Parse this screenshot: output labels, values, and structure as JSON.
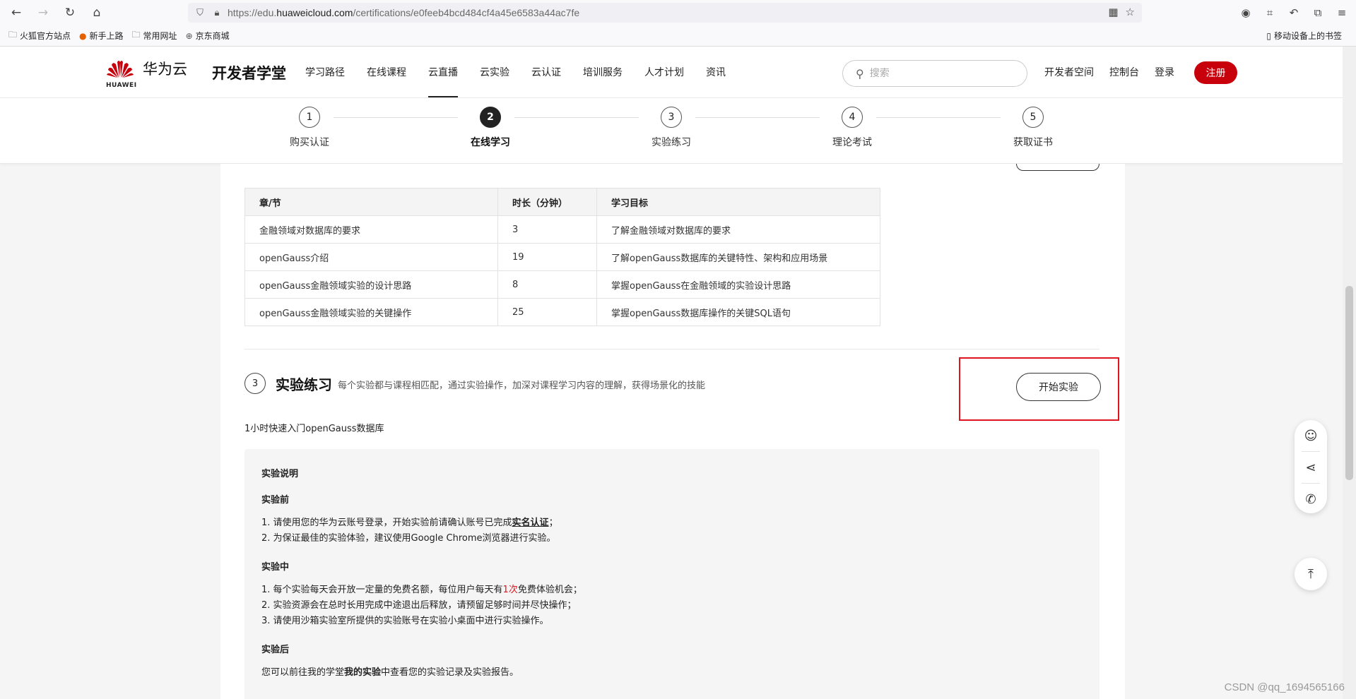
{
  "browser": {
    "url_prefix": "https://edu.",
    "url_domain": "huaweicloud.com",
    "url_path": "/certifications/e0feeb4bcd484cf4a45e6583a44ac7fe"
  },
  "bookmarks": {
    "items": [
      "火狐官方站点",
      "新手上路",
      "常用网址",
      "京东商城"
    ],
    "mobile": "移动设备上的书签"
  },
  "header": {
    "logo_caption": "HUAWEI",
    "logo_name": "华为云",
    "site_title": "开发者学堂",
    "nav": [
      "学习路径",
      "在线课程",
      "云直播",
      "云实验",
      "云认证",
      "培训服务",
      "人才计划",
      "资讯"
    ],
    "active_nav": 2,
    "search_placeholder": "搜索",
    "links": [
      "开发者空间",
      "控制台",
      "登录"
    ],
    "register": "注册"
  },
  "steps": [
    {
      "num": "1",
      "label": "购买认证"
    },
    {
      "num": "2",
      "label": "在线学习"
    },
    {
      "num": "3",
      "label": "实验练习"
    },
    {
      "num": "4",
      "label": "理论考试"
    },
    {
      "num": "5",
      "label": "获取证书"
    }
  ],
  "table": {
    "headers": [
      "章/节",
      "时长（分钟）",
      "学习目标"
    ],
    "rows": [
      [
        "金融领域对数据库的要求",
        "3",
        "了解金融领域对数据库的要求"
      ],
      [
        "openGauss介绍",
        "19",
        "了解openGauss数据库的关键特性、架构和应用场景"
      ],
      [
        "openGauss金融领域实验的设计思路",
        "8",
        "掌握openGauss在金融领域的实验设计思路"
      ],
      [
        "openGauss金融领域实验的关键操作",
        "25",
        "掌握openGauss数据库操作的关键SQL语句"
      ]
    ]
  },
  "section": {
    "num": "3",
    "title": "实验练习",
    "desc": "每个实验都与课程相匹配，通过实验操作，加深对课程学习内容的理解，获得场景化的技能",
    "start_button": "开始实验",
    "lab_name": "1小时快速入门openGauss数据库"
  },
  "lab": {
    "title": "实验说明",
    "before_title": "实验前",
    "before_1a": "1. 请使用您的华为云账号登录，开始实验前请确认账号已完成",
    "before_1b": "实名认证",
    "before_1c": "；",
    "before_2": "2. 为保证最佳的实验体验，建议使用Google Chrome浏览器进行实验。",
    "during_title": "实验中",
    "during_1a": "1. 每个实验每天会开放一定量的免费名额，每位用户每天有",
    "during_1b": "1次",
    "during_1c": "免费体验机会；",
    "during_2": "2. 实验资源会在总时长用完成中途退出后释放，请预留足够时间并尽快操作；",
    "during_3": "3. 请使用沙箱实验室所提供的实验账号在实验小桌面中进行实验操作。",
    "after_title": "实验后",
    "after_1a": "您可以前往我的学堂",
    "after_1b": "我的实验",
    "after_1c": "中查看您的实验记录及实验报告。"
  },
  "watermark": "CSDN @qq_1694565166",
  "colors": {
    "brand_red": "#c7000b",
    "highlight_red": "#e0141e"
  }
}
